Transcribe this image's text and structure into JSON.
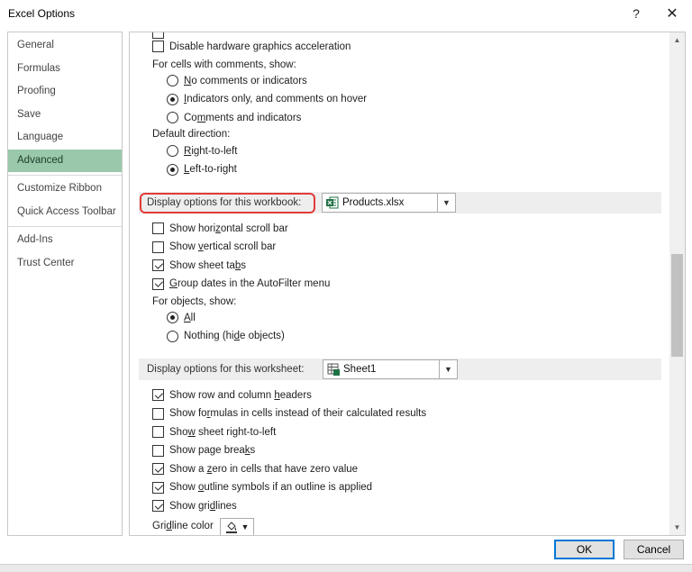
{
  "window": {
    "title": "Excel Options",
    "help_glyph": "?",
    "close_glyph": "✕"
  },
  "nav": {
    "groups": [
      [
        {
          "label": "General"
        },
        {
          "label": "Formulas"
        },
        {
          "label": "Proofing"
        },
        {
          "label": "Save"
        },
        {
          "label": "Language"
        },
        {
          "label": "Advanced",
          "selected": true
        }
      ],
      [
        {
          "label": "Customize Ribbon"
        },
        {
          "label": "Quick Access Toolbar"
        }
      ],
      [
        {
          "label": "Add-Ins"
        },
        {
          "label": "Trust Center"
        }
      ]
    ]
  },
  "display": {
    "disable_hw": {
      "pre": "Disable hardware ",
      "u": "g",
      "post": "raphics acceleration",
      "checked": false
    },
    "comments_label": "For cells with comments, show:",
    "comments_options": [
      {
        "pre": "",
        "u": "N",
        "post": "o comments or indicators",
        "checked": false
      },
      {
        "pre": "",
        "u": "I",
        "post": "ndicators only, and comments on hover",
        "checked": true
      },
      {
        "pre": "Co",
        "u": "m",
        "post": "ments and indicators",
        "checked": false
      }
    ],
    "direction_label": "Default direction:",
    "direction_options": [
      {
        "pre": "",
        "u": "R",
        "post": "ight-to-left",
        "checked": false
      },
      {
        "pre": "",
        "u": "L",
        "post": "eft-to-right",
        "checked": true
      }
    ]
  },
  "workbook": {
    "section_title": "Display options for this workbook:",
    "selected": "Products.xlsx",
    "options": [
      {
        "pre": "Show hori",
        "u": "z",
        "post": "ontal scroll bar",
        "checked": false
      },
      {
        "pre": "Show ",
        "u": "v",
        "post": "ertical scroll bar",
        "checked": false
      },
      {
        "pre": "Show sheet ta",
        "u": "b",
        "post": "s",
        "checked": true
      },
      {
        "pre": "",
        "u": "G",
        "post": "roup dates in the AutoFilter menu",
        "checked": true
      }
    ],
    "objects_label": "For objects, show:",
    "objects_options": [
      {
        "pre": "",
        "u": "A",
        "post": "ll",
        "checked": true
      },
      {
        "pre": "Nothing (hi",
        "u": "d",
        "post": "e objects)",
        "checked": false
      }
    ]
  },
  "worksheet": {
    "section_title": "Display options for this worksheet:",
    "selected": "Sheet1",
    "options": [
      {
        "pre": "Show row and column ",
        "u": "h",
        "post": "eaders",
        "checked": true
      },
      {
        "pre": "Show fo",
        "u": "r",
        "post": "mulas in cells instead of their calculated results",
        "checked": false
      },
      {
        "pre": "Sho",
        "u": "w",
        "post": " sheet right-to-left",
        "checked": false
      },
      {
        "pre": "Show page brea",
        "u": "k",
        "post": "s",
        "checked": false
      },
      {
        "pre": "Show a ",
        "u": "z",
        "post": "ero in cells that have zero value",
        "checked": true
      },
      {
        "pre": "Show ",
        "u": "o",
        "post": "utline symbols if an outline is applied",
        "checked": true
      },
      {
        "pre": "Show gri",
        "u": "d",
        "post": "lines",
        "checked": true
      }
    ],
    "gridline_color": {
      "pre": "Gri",
      "u": "d",
      "post": "line color"
    }
  },
  "footer": {
    "ok_label": "OK",
    "cancel_label": "Cancel"
  },
  "colors": {
    "nav_selected": "#99c8ab",
    "highlight": "#e23a3a",
    "excel_green": "#1e7145",
    "ok_border": "#0078d7"
  }
}
